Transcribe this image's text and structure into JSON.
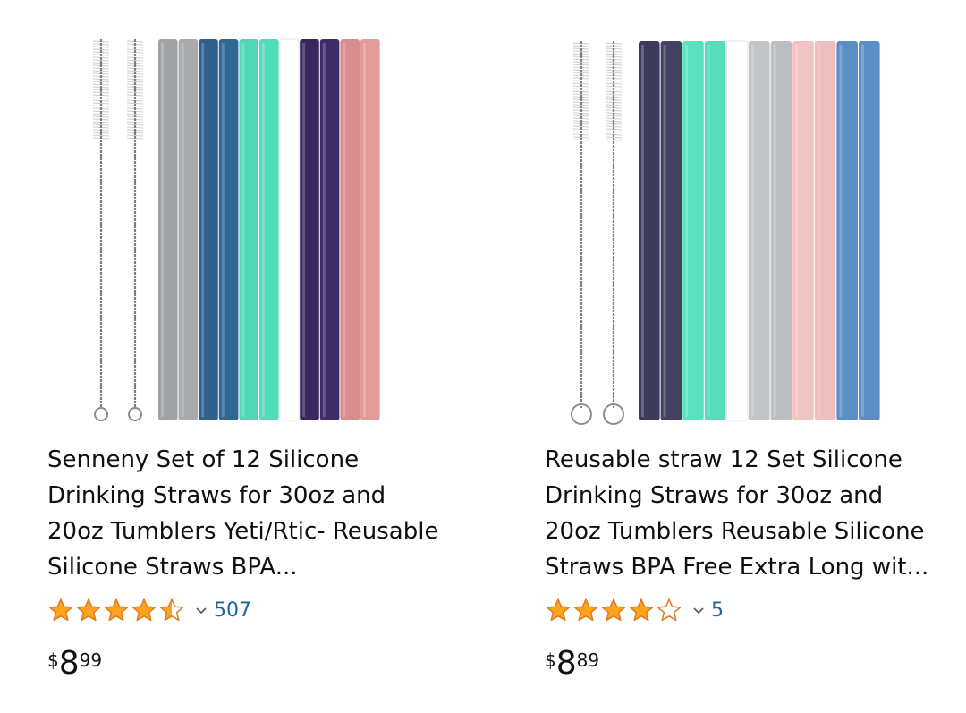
{
  "products": [
    {
      "title": "Senneny Set of 12 Silicone Drinking Straws for 30oz and 20oz Tumblers Yeti/Rtic- Reusable Silicone Straws BPA...",
      "rating_value": 4.5,
      "review_count": "507",
      "price": {
        "symbol": "$",
        "whole": "8",
        "fraction": "99"
      },
      "image": {
        "brush_count": 2,
        "straw_colors": [
          "#9fa3a6",
          "#a7abae",
          "#2f5f8c",
          "#2f6796",
          "#4ed8b5",
          "#52dcb9",
          "#ffffff",
          "#3a2660",
          "#3f2b68",
          "#d98c8c",
          "#e39a9a"
        ]
      }
    },
    {
      "title": "Reusable straw 12 Set Silicone Drinking Straws for 30oz and 20oz Tumblers Reusable Silicone Straws BPA Free Extra Long wit...",
      "rating_value": 4.0,
      "review_count": "5",
      "price": {
        "symbol": "$",
        "whole": "8",
        "fraction": "89"
      },
      "image": {
        "brush_count": 2,
        "straw_colors": [
          "#3d3b5c",
          "#44425f",
          "#5be0bf",
          "#57dcbb",
          "#ffffff",
          "#c2c4c6",
          "#bcbec0",
          "#f2c3c3",
          "#efbebe",
          "#5a8fc6",
          "#5b8ec4"
        ]
      }
    }
  ],
  "colors": {
    "star_fill": "#ffa41c",
    "star_stroke": "#de7921",
    "link": "#2162a1",
    "text": "#0f1111"
  }
}
